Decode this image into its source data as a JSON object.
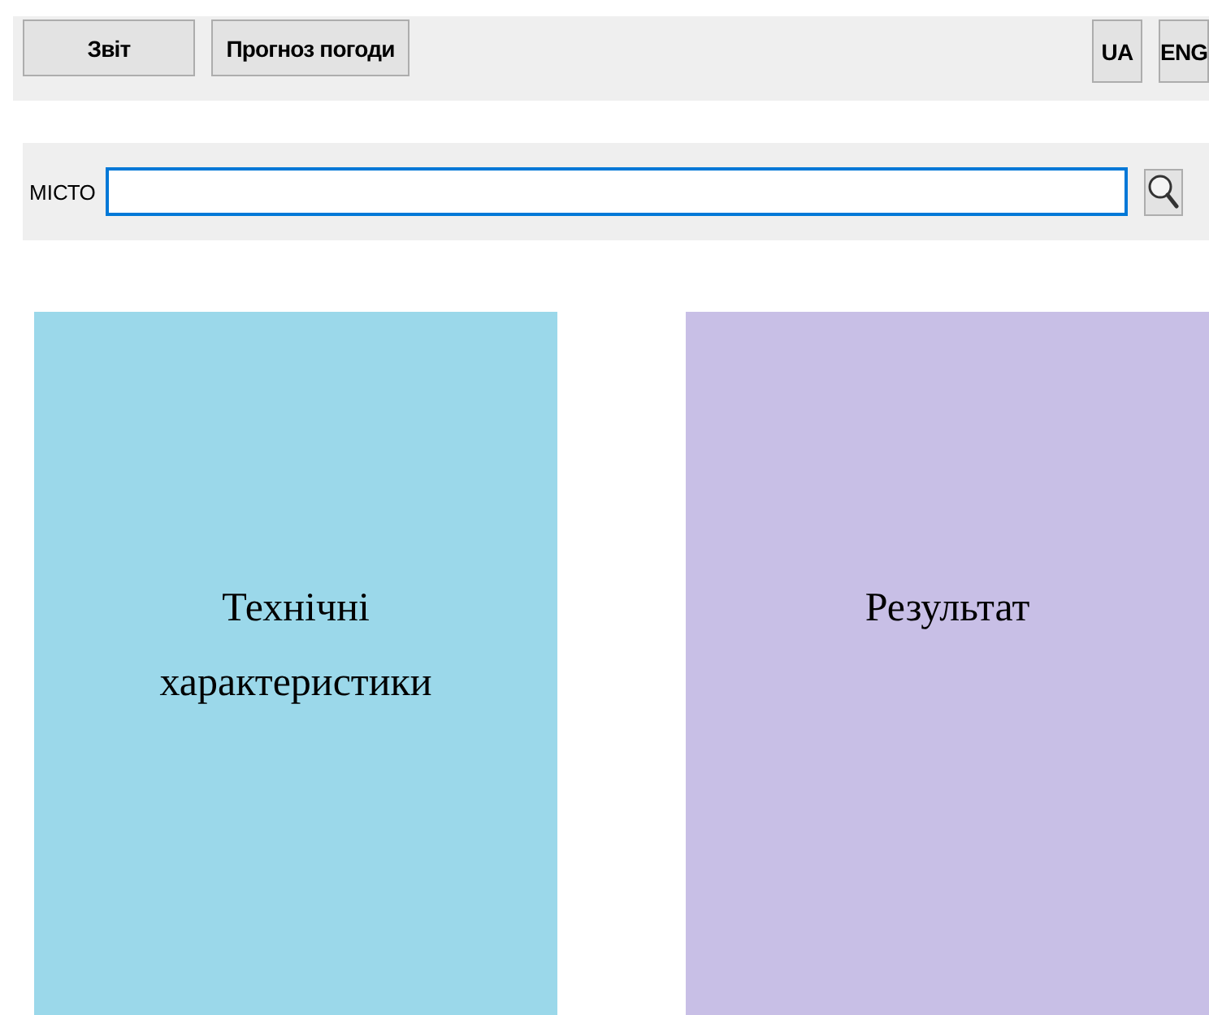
{
  "toolbar": {
    "buttons": [
      {
        "label": "Звіт"
      },
      {
        "label": "Прогноз погоди"
      }
    ],
    "languages": [
      {
        "label": "UA"
      },
      {
        "label": "ENG"
      }
    ]
  },
  "search": {
    "label": "МІСТО",
    "focused": true
  },
  "panels": [
    {
      "title": "Технічні характеристики",
      "color": "#9bd8ea"
    },
    {
      "title": "Результат",
      "color": "#c8bfe6"
    }
  ]
}
